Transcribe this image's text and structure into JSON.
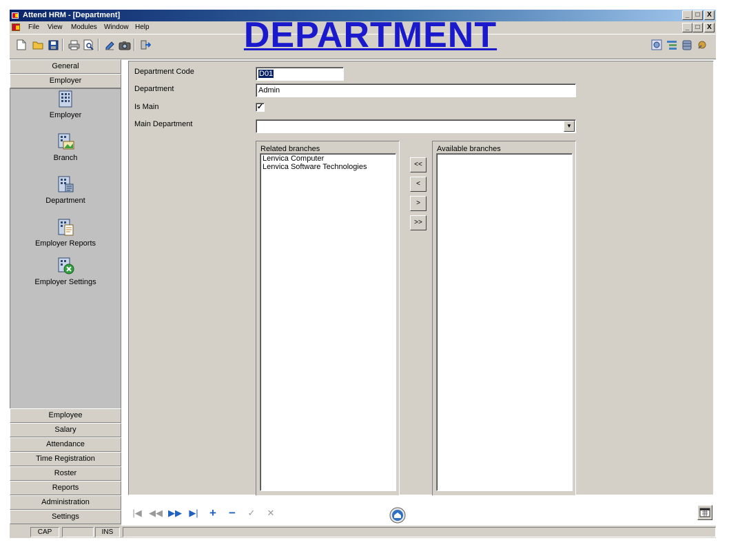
{
  "window": {
    "title": "Attend HRM - [Department]",
    "controls": [
      "_",
      "□",
      "X"
    ]
  },
  "mdi_controls": [
    "_",
    "□",
    "X"
  ],
  "menu": [
    "File",
    "View",
    "Modules",
    "Window",
    "Help"
  ],
  "heading": "DEPARTMENT",
  "sidebar": {
    "top_sections": [
      "General",
      "Employer"
    ],
    "items": [
      {
        "label": "Employer",
        "icon": "building-icon"
      },
      {
        "label": "Branch",
        "icon": "branch-icon"
      },
      {
        "label": "Department",
        "icon": "department-icon"
      },
      {
        "label": "Employer Reports",
        "icon": "reports-icon"
      },
      {
        "label": "Employer Settings",
        "icon": "settings-icon"
      }
    ],
    "bottom_sections": [
      "Employee",
      "Salary",
      "Attendance",
      "Time Registration",
      "Roster",
      "Reports",
      "Administration",
      "Settings"
    ]
  },
  "form": {
    "department_code_label": "Department Code",
    "department_code_value": "D01",
    "department_label": "Department",
    "department_value": "Admin",
    "is_main_label": "Is Main",
    "is_main_checked": true,
    "is_main_mark": "✓",
    "main_department_label": "Main Department",
    "main_department_value": ""
  },
  "related_branches": {
    "title": "Related branches",
    "items": [
      "Lenvica Computer",
      "Lenvica Software Technologies"
    ]
  },
  "available_branches": {
    "title": "Available branches",
    "items": []
  },
  "transfer_buttons": [
    "<<",
    "<",
    ">",
    ">>"
  ],
  "navigator": [
    "|◀",
    "◀◀",
    "▶▶",
    "▶|",
    "+",
    "−",
    "✓",
    "✕"
  ],
  "status": {
    "cap": "CAP",
    "ins": "INS"
  },
  "colors": {
    "title_gradient_start": "#0a246a",
    "heading": "#1a1acc",
    "face": "#d4d0c8",
    "nav_accent": "#2060c0"
  }
}
